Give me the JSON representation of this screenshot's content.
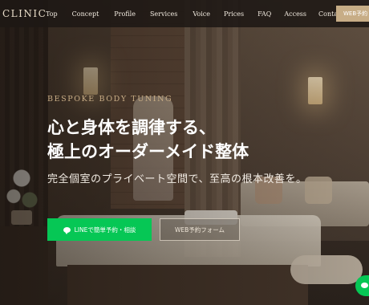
{
  "header": {
    "logo": "CLINIC",
    "nav": [
      "Top",
      "Concept",
      "Profile",
      "Services",
      "Voice",
      "Prices",
      "FAQ",
      "Access",
      "Contact"
    ],
    "cta_label": "WEB予約"
  },
  "hero": {
    "eyebrow": "BESPOKE BODY TUNING",
    "headline_line1": "心と身体を調律する、",
    "headline_line2": "極上のオーダーメイド整体",
    "subtext": "完全個室のプライベート空間で、至高の根本改善を。",
    "btn_line_label": "LINEで簡単予約・相談",
    "btn_web_label": "WEB予約フォーム"
  },
  "colors": {
    "accent_gold": "#c7ad86",
    "line_green": "#06c755",
    "header_bg": "#1e1814"
  }
}
